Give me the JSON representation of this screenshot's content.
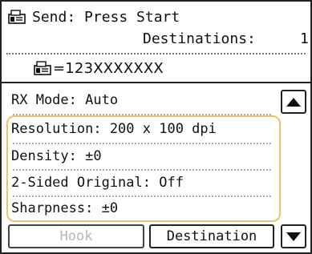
{
  "header": {
    "title": "Send: Press Start",
    "destinations_label": "Destinations:",
    "destinations_count": "1",
    "fax_number": "=123XXXXXXX",
    "title_icon": "fax-icon",
    "number_icon": "fax-icon"
  },
  "settings": [
    {
      "label": "RX Mode: Auto"
    },
    {
      "label": "Resolution: 200 x 100 dpi"
    },
    {
      "label": "Density: ±0"
    },
    {
      "label": "2-Sided Original: Off"
    },
    {
      "label": "Sharpness: ±0"
    }
  ],
  "buttons": {
    "hook": "Hook",
    "destination": "Destination",
    "scroll_up_icon": "up-arrow-icon",
    "scroll_down_icon": "down-arrow-icon"
  },
  "colors": {
    "highlight_border": "#f0c36a",
    "disabled_text": "#b8b8b8"
  }
}
